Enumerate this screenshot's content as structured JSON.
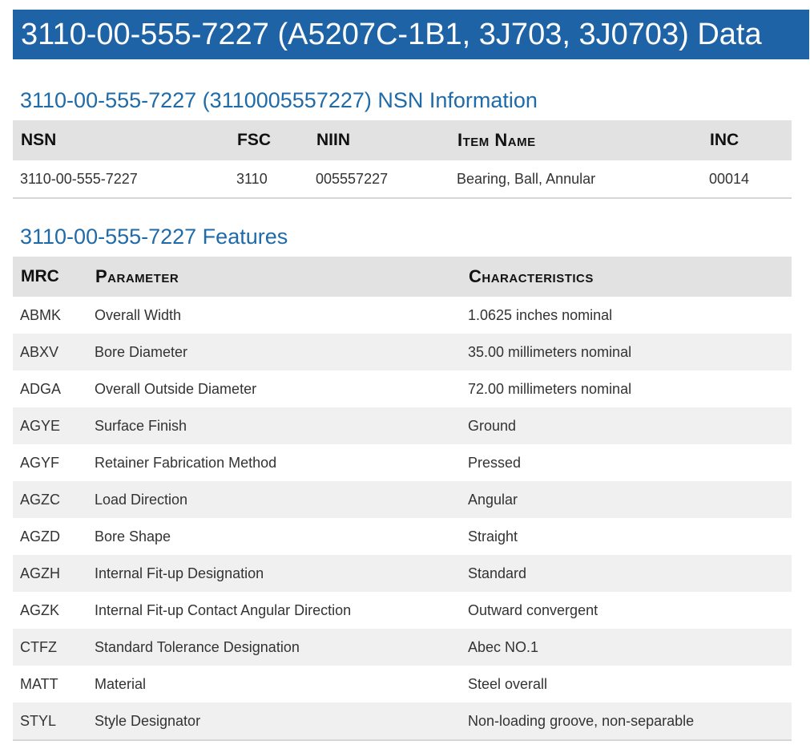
{
  "banner": {
    "title": "3110-00-555-7227 (A5207C-1B1, 3J703, 3J0703) Data"
  },
  "nsn_section": {
    "title": "3110-00-555-7227 (3110005557227) NSN Information",
    "headers": [
      "NSN",
      "FSC",
      "NIIN",
      "Item Name",
      "INC"
    ],
    "row": [
      "3110-00-555-7227",
      "3110",
      "005557227",
      "Bearing, Ball, Annular",
      "00014"
    ]
  },
  "features_section": {
    "title": "3110-00-555-7227 Features",
    "headers": [
      "MRC",
      "Parameter",
      "Characteristics"
    ],
    "rows": [
      [
        "ABMK",
        "Overall Width",
        "1.0625 inches nominal"
      ],
      [
        "ABXV",
        "Bore Diameter",
        "35.00 millimeters nominal"
      ],
      [
        "ADGA",
        "Overall Outside Diameter",
        "72.00 millimeters nominal"
      ],
      [
        "AGYE",
        "Surface Finish",
        "Ground"
      ],
      [
        "AGYF",
        "Retainer Fabrication Method",
        "Pressed"
      ],
      [
        "AGZC",
        "Load Direction",
        "Angular"
      ],
      [
        "AGZD",
        "Bore Shape",
        "Straight"
      ],
      [
        "AGZH",
        "Internal Fit-up Designation",
        "Standard"
      ],
      [
        "AGZK",
        "Internal Fit-up Contact Angular Direction",
        "Outward convergent"
      ],
      [
        "CTFZ",
        "Standard Tolerance Designation",
        "Abec NO.1"
      ],
      [
        "MATT",
        "Material",
        "Steel overall"
      ],
      [
        "STYL",
        "Style Designator",
        "Non-loading groove, non-separable"
      ]
    ]
  }
}
